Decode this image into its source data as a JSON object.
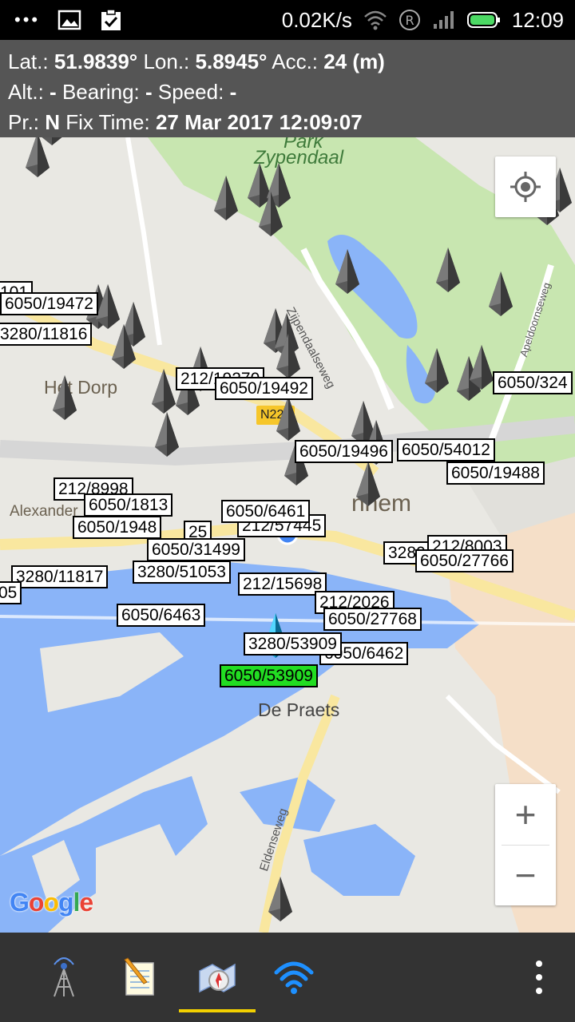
{
  "status_bar": {
    "dots": "•••",
    "net_speed": "0.02K/s",
    "time": "12:09",
    "icons": [
      "gallery-icon",
      "clipboard-check-icon",
      "wifi-icon",
      "roaming-icon",
      "signal-icon",
      "battery-icon"
    ]
  },
  "info": {
    "lat_label": "Lat.:",
    "lat_value": "51.9839°",
    "lon_label": "Lon.:",
    "lon_value": "5.8945°",
    "acc_label": "Acc.:",
    "acc_value": "24 (m)",
    "alt_label": "Alt.:",
    "alt_value": "-",
    "bearing_label": "Bearing:",
    "bearing_value": "-",
    "speed_label": "Speed:",
    "speed_value": "-",
    "pr_label": "Pr.:",
    "pr_value": "N",
    "fix_label": "Fix Time:",
    "fix_value": "27 Mar 2017 12:09:07"
  },
  "map": {
    "places": {
      "park": "Park",
      "zypendaal": "Zypendaal",
      "het_dorp": "Het Dorp",
      "alexander": "Alexander",
      "arnhem": "nhem",
      "de_praets": "De Praets"
    },
    "roads": {
      "n224": "N224",
      "zijpendaalseweg": "Zijpendaalseweg",
      "apeldoornseweg": "Apeldoornseweg",
      "eldenseweg": "Eldenseweg"
    },
    "cell_labels": [
      "6050/19472",
      "3280/11816",
      "212/19270",
      "6050/19492",
      "6050/19496",
      "6050/54012",
      "6050/19488",
      "6050/324",
      "212/8998",
      "6050/1813",
      "6050/1948",
      "6050/31499",
      "3280/51053",
      "212/57445",
      "6050/6461",
      "212/15698",
      "212/2026",
      "6050/27768",
      "3280/51050",
      "6050/27766",
      "6050/6463",
      "3280/11817",
      "6050/6462",
      "3280/53909",
      "6050/53909",
      "212/8003",
      "25",
      "05",
      "101"
    ],
    "selected_cell": "6050/53909",
    "zoom_in": "+",
    "zoom_out": "−",
    "attribution": "Google",
    "colors": {
      "land": "#e9e8e3",
      "water": "#8ab4f8",
      "park": "#c8e6b0",
      "road_major": "#f9e79f",
      "selected_label": "#22dd22",
      "urban": "#f5dfc8"
    }
  },
  "bottom_bar": {
    "tabs": [
      {
        "icon": "cell-tower-icon"
      },
      {
        "icon": "notepad-icon"
      },
      {
        "icon": "compass-map-icon",
        "active": true
      },
      {
        "icon": "wifi-tab-icon"
      }
    ],
    "overflow_icon": "more-vert-icon"
  }
}
